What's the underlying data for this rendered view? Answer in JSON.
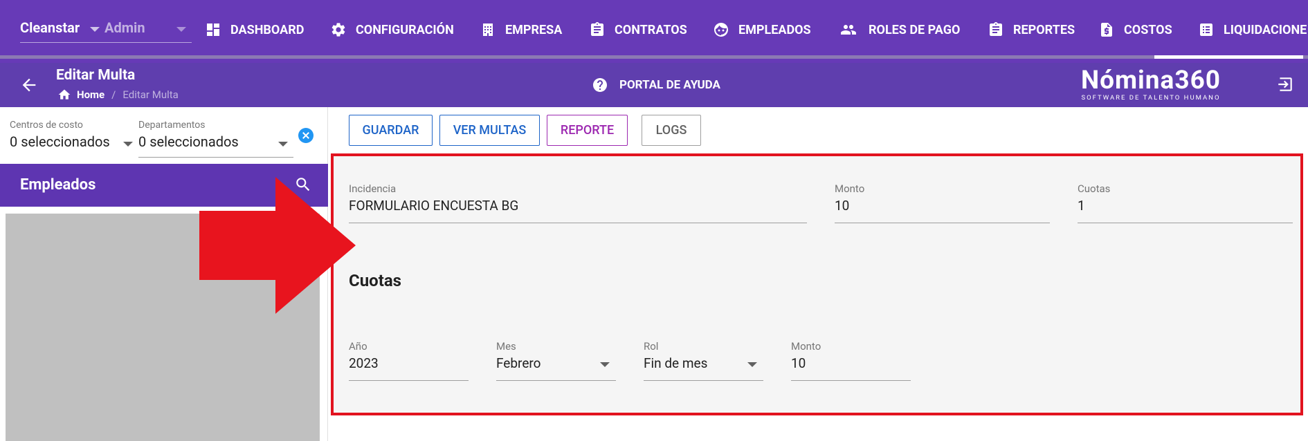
{
  "topnav": {
    "company": "Cleanstar",
    "role": "Admin",
    "items": [
      {
        "label": "DASHBOARD",
        "icon": "dashboard-icon"
      },
      {
        "label": "CONFIGURACIÓN",
        "icon": "gear-icon"
      },
      {
        "label": "EMPRESA",
        "icon": "building-icon"
      },
      {
        "label": "CONTRATOS",
        "icon": "clipboard-icon"
      },
      {
        "label": "EMPLEADOS",
        "icon": "face-icon"
      },
      {
        "label": "ROLES DE PAGO",
        "icon": "group-icon"
      },
      {
        "label": "REPORTES",
        "icon": "report-clipboard-icon"
      },
      {
        "label": "COSTOS",
        "icon": "receipt-dollar-icon"
      },
      {
        "label": "LIQUIDACIONE",
        "icon": "list-icon"
      }
    ]
  },
  "subheader": {
    "title": "Editar Multa",
    "breadcrumb_home": "Home",
    "breadcrumb_separator": "/",
    "breadcrumb_current": "Editar Multa",
    "help": "PORTAL DE AYUDA",
    "logo_main": "Nómina360",
    "logo_sub": "SOFTWARE DE TALENTO HUMANO"
  },
  "filters": {
    "cost_centers_label": "Centros de costo",
    "cost_centers_value": "0 seleccionados",
    "departments_label": "Departamentos",
    "departments_value": "0 seleccionados"
  },
  "employees": {
    "title": "Empleados"
  },
  "toolbar": {
    "save": "GUARDAR",
    "view_fines": "VER MULTAS",
    "report": "REPORTE",
    "logs": "LOGS"
  },
  "form": {
    "incidence_label": "Incidencia",
    "incidence_value": "FORMULARIO ENCUESTA BG",
    "amount_label": "Monto",
    "amount_value": "10",
    "installments_label": "Cuotas",
    "installments_value": "1",
    "section_title": "Cuotas",
    "year_label": "Año",
    "year_value": "2023",
    "month_label": "Mes",
    "month_value": "Febrero",
    "role_label": "Rol",
    "role_value": "Fin de mes",
    "row_amount_label": "Monto",
    "row_amount_value": "10"
  },
  "colors": {
    "nav": "#673ab7",
    "subheader": "#5f3eae",
    "primary_button": "#1e64c8",
    "report_button": "#9c27b0",
    "highlight": "#e2131f"
  }
}
